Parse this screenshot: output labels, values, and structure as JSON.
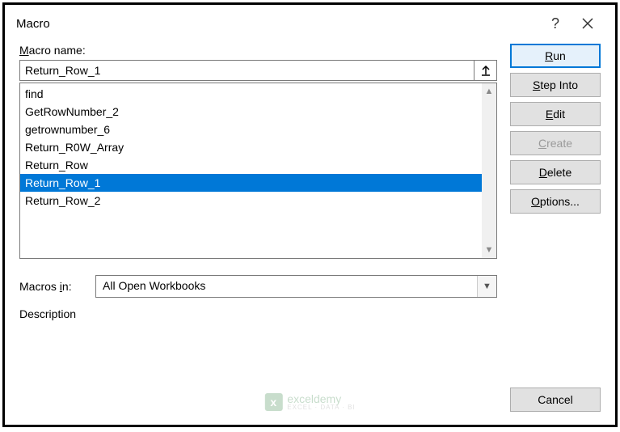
{
  "titlebar": {
    "title": "Macro"
  },
  "labels": {
    "macro_name": "acro name:",
    "macros_in": "Macros ",
    "macros_in_suffix": "n:",
    "description": "Description"
  },
  "macro_name_value": "Return_Row_1",
  "list": [
    "find",
    "GetRowNumber_2",
    "getrownumber_6",
    "Return_R0W_Array",
    "Return_Row",
    "Return_Row_1",
    "Return_Row_2"
  ],
  "selected_index": 5,
  "macros_in_value": "All Open Workbooks",
  "buttons": {
    "run": "un",
    "step_into": "tep Into",
    "edit": "dit",
    "create": "reate",
    "delete": "elete",
    "options": "ptions...",
    "cancel": "Cancel"
  },
  "watermark": {
    "brand": "exceldemy",
    "sub": "EXCEL · DATA · BI"
  }
}
